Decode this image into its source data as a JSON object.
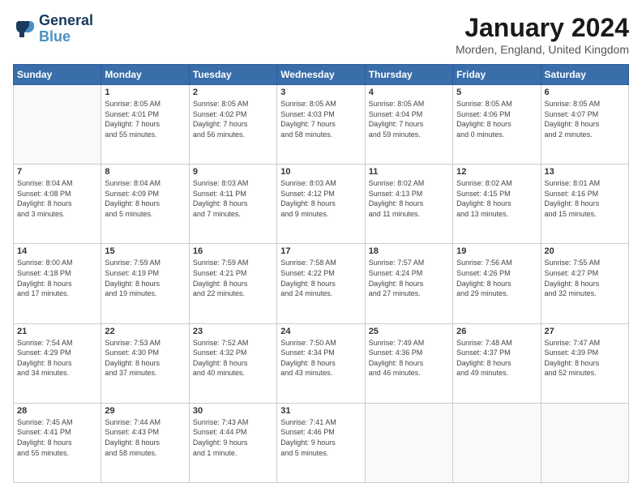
{
  "logo": {
    "line1": "General",
    "line2": "Blue"
  },
  "title": "January 2024",
  "location": "Morden, England, United Kingdom",
  "days_of_week": [
    "Sunday",
    "Monday",
    "Tuesday",
    "Wednesday",
    "Thursday",
    "Friday",
    "Saturday"
  ],
  "weeks": [
    [
      {
        "day": "",
        "info": ""
      },
      {
        "day": "1",
        "info": "Sunrise: 8:05 AM\nSunset: 4:01 PM\nDaylight: 7 hours\nand 55 minutes."
      },
      {
        "day": "2",
        "info": "Sunrise: 8:05 AM\nSunset: 4:02 PM\nDaylight: 7 hours\nand 56 minutes."
      },
      {
        "day": "3",
        "info": "Sunrise: 8:05 AM\nSunset: 4:03 PM\nDaylight: 7 hours\nand 58 minutes."
      },
      {
        "day": "4",
        "info": "Sunrise: 8:05 AM\nSunset: 4:04 PM\nDaylight: 7 hours\nand 59 minutes."
      },
      {
        "day": "5",
        "info": "Sunrise: 8:05 AM\nSunset: 4:06 PM\nDaylight: 8 hours\nand 0 minutes."
      },
      {
        "day": "6",
        "info": "Sunrise: 8:05 AM\nSunset: 4:07 PM\nDaylight: 8 hours\nand 2 minutes."
      }
    ],
    [
      {
        "day": "7",
        "info": "Sunrise: 8:04 AM\nSunset: 4:08 PM\nDaylight: 8 hours\nand 3 minutes."
      },
      {
        "day": "8",
        "info": "Sunrise: 8:04 AM\nSunset: 4:09 PM\nDaylight: 8 hours\nand 5 minutes."
      },
      {
        "day": "9",
        "info": "Sunrise: 8:03 AM\nSunset: 4:11 PM\nDaylight: 8 hours\nand 7 minutes."
      },
      {
        "day": "10",
        "info": "Sunrise: 8:03 AM\nSunset: 4:12 PM\nDaylight: 8 hours\nand 9 minutes."
      },
      {
        "day": "11",
        "info": "Sunrise: 8:02 AM\nSunset: 4:13 PM\nDaylight: 8 hours\nand 11 minutes."
      },
      {
        "day": "12",
        "info": "Sunrise: 8:02 AM\nSunset: 4:15 PM\nDaylight: 8 hours\nand 13 minutes."
      },
      {
        "day": "13",
        "info": "Sunrise: 8:01 AM\nSunset: 4:16 PM\nDaylight: 8 hours\nand 15 minutes."
      }
    ],
    [
      {
        "day": "14",
        "info": "Sunrise: 8:00 AM\nSunset: 4:18 PM\nDaylight: 8 hours\nand 17 minutes."
      },
      {
        "day": "15",
        "info": "Sunrise: 7:59 AM\nSunset: 4:19 PM\nDaylight: 8 hours\nand 19 minutes."
      },
      {
        "day": "16",
        "info": "Sunrise: 7:59 AM\nSunset: 4:21 PM\nDaylight: 8 hours\nand 22 minutes."
      },
      {
        "day": "17",
        "info": "Sunrise: 7:58 AM\nSunset: 4:22 PM\nDaylight: 8 hours\nand 24 minutes."
      },
      {
        "day": "18",
        "info": "Sunrise: 7:57 AM\nSunset: 4:24 PM\nDaylight: 8 hours\nand 27 minutes."
      },
      {
        "day": "19",
        "info": "Sunrise: 7:56 AM\nSunset: 4:26 PM\nDaylight: 8 hours\nand 29 minutes."
      },
      {
        "day": "20",
        "info": "Sunrise: 7:55 AM\nSunset: 4:27 PM\nDaylight: 8 hours\nand 32 minutes."
      }
    ],
    [
      {
        "day": "21",
        "info": "Sunrise: 7:54 AM\nSunset: 4:29 PM\nDaylight: 8 hours\nand 34 minutes."
      },
      {
        "day": "22",
        "info": "Sunrise: 7:53 AM\nSunset: 4:30 PM\nDaylight: 8 hours\nand 37 minutes."
      },
      {
        "day": "23",
        "info": "Sunrise: 7:52 AM\nSunset: 4:32 PM\nDaylight: 8 hours\nand 40 minutes."
      },
      {
        "day": "24",
        "info": "Sunrise: 7:50 AM\nSunset: 4:34 PM\nDaylight: 8 hours\nand 43 minutes."
      },
      {
        "day": "25",
        "info": "Sunrise: 7:49 AM\nSunset: 4:36 PM\nDaylight: 8 hours\nand 46 minutes."
      },
      {
        "day": "26",
        "info": "Sunrise: 7:48 AM\nSunset: 4:37 PM\nDaylight: 8 hours\nand 49 minutes."
      },
      {
        "day": "27",
        "info": "Sunrise: 7:47 AM\nSunset: 4:39 PM\nDaylight: 8 hours\nand 52 minutes."
      }
    ],
    [
      {
        "day": "28",
        "info": "Sunrise: 7:45 AM\nSunset: 4:41 PM\nDaylight: 8 hours\nand 55 minutes."
      },
      {
        "day": "29",
        "info": "Sunrise: 7:44 AM\nSunset: 4:43 PM\nDaylight: 8 hours\nand 58 minutes."
      },
      {
        "day": "30",
        "info": "Sunrise: 7:43 AM\nSunset: 4:44 PM\nDaylight: 9 hours\nand 1 minute."
      },
      {
        "day": "31",
        "info": "Sunrise: 7:41 AM\nSunset: 4:46 PM\nDaylight: 9 hours\nand 5 minutes."
      },
      {
        "day": "",
        "info": ""
      },
      {
        "day": "",
        "info": ""
      },
      {
        "day": "",
        "info": ""
      }
    ]
  ]
}
